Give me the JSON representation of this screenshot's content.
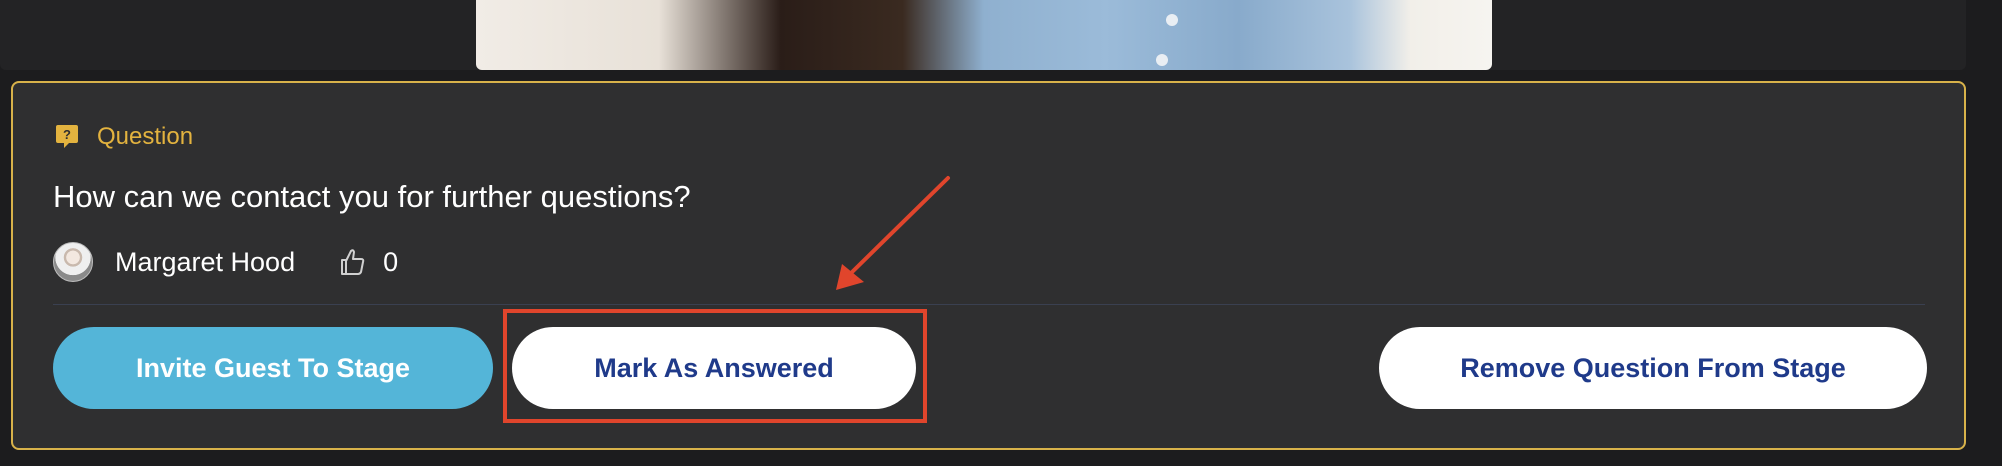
{
  "question": {
    "label": "Question",
    "text": "How can we contact you for further questions?",
    "author": "Margaret Hood",
    "like_count": "0"
  },
  "actions": {
    "invite_label": "Invite Guest To Stage",
    "mark_answered_label": "Mark As Answered",
    "remove_label": "Remove Question From Stage"
  },
  "colors": {
    "accent_gold": "#e3b33f",
    "card_border": "#d8b24a",
    "invite_button": "#54b5d8",
    "button_text_blue": "#1f3a8a",
    "annotation_red": "#e0452c"
  },
  "icons": {
    "question": "question-bubble-icon",
    "like": "thumbs-up-icon"
  }
}
